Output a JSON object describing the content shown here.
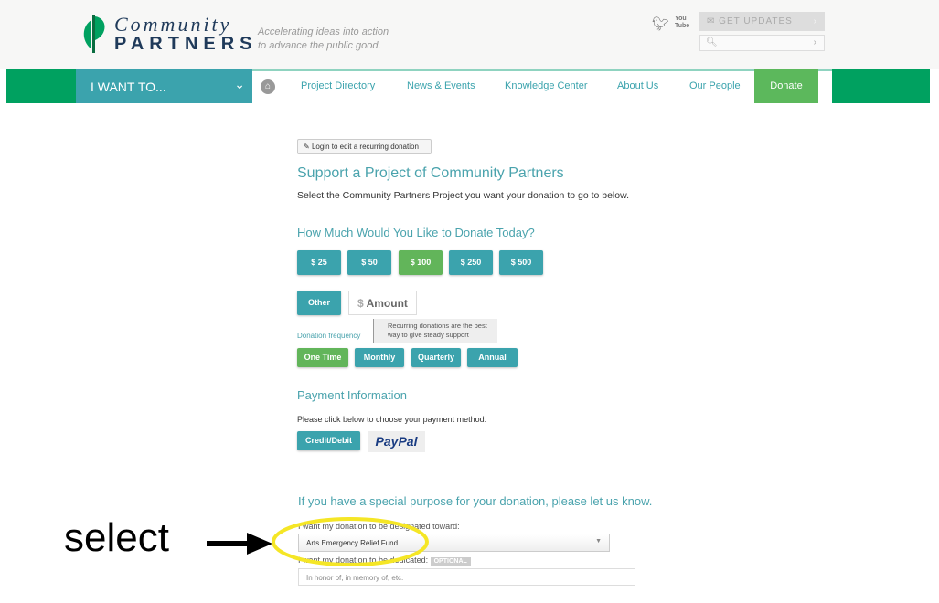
{
  "header": {
    "logo_line1": "Community",
    "logo_line2": "PARTNERS",
    "tagline_1": "Accelerating ideas into action",
    "tagline_2": "to advance the public good.",
    "social": [
      "twitter-icon",
      "youtube-icon"
    ],
    "youtube_text": "You Tube",
    "updates_label": "GET UPDATES",
    "search_placeholder": ""
  },
  "nav": {
    "i_want": "I WANT TO...",
    "items": [
      "Project Directory",
      "News & Events",
      "Knowledge Center",
      "About Us",
      "Our People"
    ],
    "donate": "Donate"
  },
  "main": {
    "login_button": "Login to edit a recurring donation",
    "title": "Support a Project of Community Partners",
    "subtitle": "Select the Community Partners Project you want your donation to go to below.",
    "amount_heading": "How Much Would You Like to Donate Today?",
    "amounts": [
      "$ 25",
      "$ 50",
      "$ 100",
      "$ 250",
      "$ 500"
    ],
    "selected_amount": "$ 100",
    "other_label": "Other",
    "amount_placeholder": "Amount",
    "currency": "$",
    "frequency_label": "Donation frequency",
    "frequency_tip": "Recurring donations are the best way to give steady support",
    "frequencies": [
      "One Time",
      "Monthly",
      "Quarterly",
      "Annual"
    ],
    "selected_frequency": "One Time",
    "payment_heading": "Payment Information",
    "payment_text": "Please click below to choose your payment method.",
    "credit_label": "Credit/Debit",
    "paypal_label": "PayPal",
    "purpose_heading": "If you have a special purpose for your donation, please let us know.",
    "designate_label": "I want my donation to be designated toward:",
    "designate_value": "Arts Emergency Relief Fund",
    "dedicate_label": "I want my donation to be dedicated:",
    "optional_badge": "OPTIONAL",
    "dedicate_placeholder": "In honor of, in memory of, etc."
  },
  "annotation": {
    "text": "select",
    "highlight_color": "#f5e626"
  }
}
